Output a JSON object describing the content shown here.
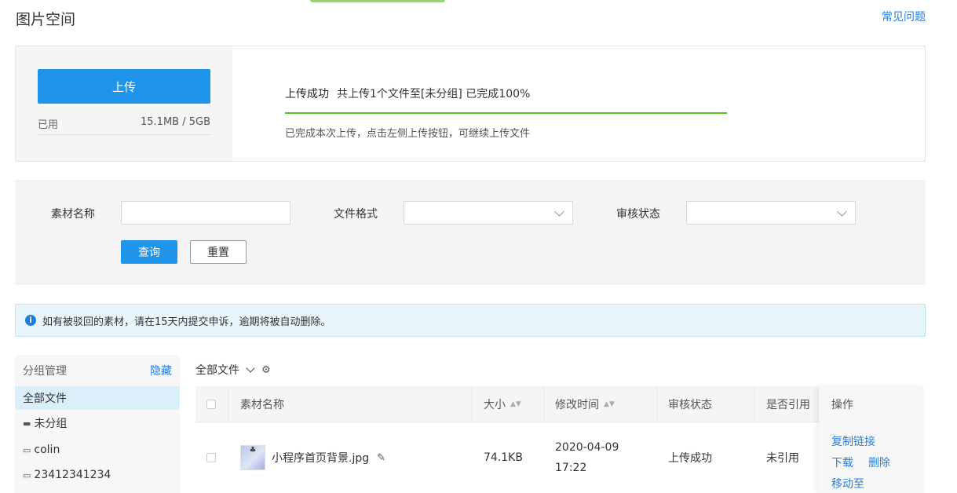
{
  "page": {
    "title": "图片空间",
    "faq_link": "常见问题"
  },
  "upload": {
    "button_label": "上传",
    "used_label": "已用",
    "used_value": "15.1MB / 5GB",
    "status_strong": "上传成功",
    "status_detail": "共上传1个文件至[未分组] 已完成100%",
    "progress_percent": 100,
    "status_sub": "已完成本次上传，点击左侧上传按钮，可继续上传文件",
    "progress_color": "#52c41a"
  },
  "filter": {
    "name_label": "素材名称",
    "name_value": "",
    "format_label": "文件格式",
    "format_value": "",
    "review_label": "审核状态",
    "review_value": "",
    "query_button": "查询",
    "reset_button": "重置"
  },
  "notice": {
    "icon": "info-icon",
    "text": "如有被驳回的素材，请在15天内提交申诉，逾期将被自动删除。"
  },
  "groups": {
    "header": "分组管理",
    "hide_link": "隐藏",
    "items": [
      {
        "label": "全部文件",
        "icon": "",
        "active": true
      },
      {
        "label": "未分组",
        "icon": "folder-filled-icon",
        "active": false
      },
      {
        "label": "colin",
        "icon": "folder-outline-icon",
        "active": false
      },
      {
        "label": "23412341234",
        "icon": "folder-outline-icon",
        "active": false
      }
    ]
  },
  "files": {
    "header": "全部文件",
    "columns": [
      "素材名称",
      "大小",
      "修改时间",
      "审核状态",
      "是否引用",
      "操作"
    ],
    "rows": [
      {
        "name": "小程序首页背景.jpg",
        "size": "74.1KB",
        "modified_date": "2020-04-09",
        "modified_time": "17:22",
        "review_status": "上传成功",
        "referenced": "未引用",
        "actions": [
          "复制链接",
          "下载",
          "删除",
          "移动至"
        ]
      }
    ]
  },
  "colors": {
    "primary": "#1e95e8",
    "link": "#2b7fd6",
    "success": "#52c41a"
  }
}
